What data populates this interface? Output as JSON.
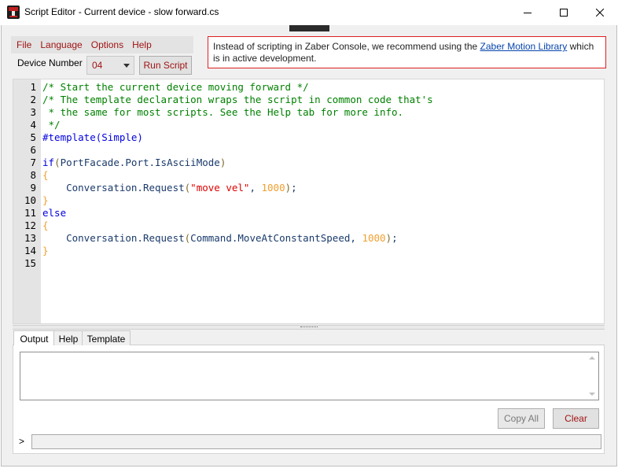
{
  "window": {
    "title": "Script Editor - Current device - slow forward.cs"
  },
  "menu": {
    "items": [
      "File",
      "Language",
      "Options",
      "Help"
    ]
  },
  "device": {
    "label": "Device Number",
    "selected": "04"
  },
  "run_button_label": "Run Script",
  "notice": {
    "text_before": "Instead of scripting in Zaber Console, we recommend using the ",
    "link": "Zaber Motion Library",
    "text_after": " which is in active development."
  },
  "editor": {
    "line_numbers": [
      "1",
      "2",
      "3",
      "4",
      "5",
      "6",
      "7",
      "8",
      "9",
      "10",
      "11",
      "12",
      "13",
      "14",
      "15"
    ],
    "lines": [
      "/* Start the current device moving forward */",
      "/* The template declaration wraps the script in common code that's",
      " * the same for most scripts. See the Help tab for more info.",
      " */",
      "#template(Simple)",
      "",
      "if(PortFacade.Port.IsAsciiMode)",
      "{",
      "    Conversation.Request(\"move vel\", 1000);",
      "}",
      "else",
      "{",
      "    Conversation.Request(Command.MoveAtConstantSpeed, 1000);",
      "}",
      ""
    ]
  },
  "tabs": [
    "Output",
    "Help",
    "Template"
  ],
  "output": {
    "text": ""
  },
  "buttons": {
    "copy_all": "Copy All",
    "clear": "Clear"
  },
  "command": {
    "prompt": ">",
    "value": ""
  },
  "colors": {
    "accent_text": "#a01414",
    "comment": "#008000",
    "keyword": "#0000e0",
    "string": "#e00000",
    "number": "#f0a030",
    "notice_border": "#e02020"
  }
}
